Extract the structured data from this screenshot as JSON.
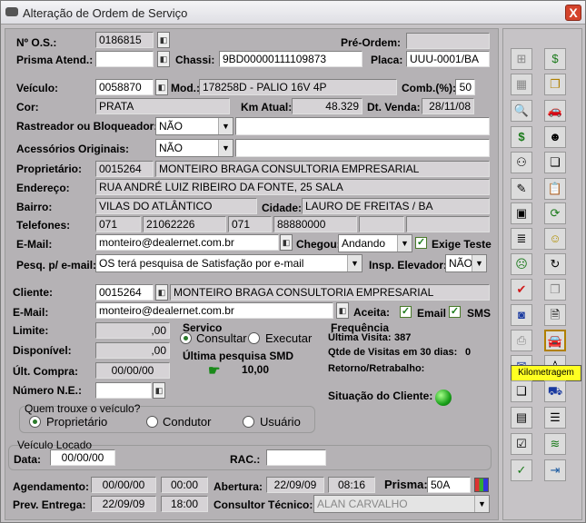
{
  "window": {
    "title": "Alteração de Ordem de Serviço",
    "close": "X"
  },
  "os": {
    "label": "Nº O.S.:",
    "value": "0186815",
    "pre_ordem_label": "Pré-Ordem:",
    "pre_ordem_value": "",
    "prisma_atend_label": "Prisma Atend.:",
    "prisma_atend_value": "",
    "chassi_label": "Chassi:",
    "chassi_value": "9BD00000111109873",
    "placa_label": "Placa:",
    "placa_value": "UUU-0001/BA"
  },
  "veiculo": {
    "label": "Veículo:",
    "code": "0058870",
    "mod_label": "Mod.:",
    "mod_value": "178258D - PALIO 16V 4P",
    "comb_label": "Comb.(%):",
    "comb_value": "50",
    "cor_label": "Cor:",
    "cor_value": "PRATA",
    "km_label": "Km Atual:",
    "km_value": "48.329",
    "dtvenda_label": "Dt. Venda:",
    "dtvenda_value": "28/11/08",
    "rastreador_label": "Rastreador ou Bloqueador:",
    "rastreador_value": "NÃO",
    "rastreador_text": "",
    "acessorios_label": "Acessórios Originais:",
    "acessorios_value": "NÃO",
    "acessorios_text": ""
  },
  "proprietario": {
    "label": "Proprietário:",
    "code": "0015264",
    "name": "MONTEIRO BRAGA CONSULTORIA EMPRESARIAL",
    "endereco_label": "Endereço:",
    "endereco_value": "RUA ANDRÉ LUIZ RIBEIRO DA FONTE, 25 SALA",
    "bairro_label": "Bairro:",
    "bairro_value": "VILAS DO ATLÂNTICO",
    "cidade_label": "Cidade:",
    "cidade_value": "LAURO DE FREITAS / BA",
    "telefones_label": "Telefones:",
    "ddd1": "071",
    "tel1": "21062226",
    "ddd2": "071",
    "tel2": "88880000",
    "email_label": "E-Mail:",
    "email_value": "monteiro@dealernet.com.br",
    "chegou_label": "Chegou:",
    "chegou_value": "Andando",
    "exige_teste_label": "Exige Teste",
    "pesq_label": "Pesq. p/ e-mail:",
    "pesq_value": "OS terá pesquisa de Satisfação por e-mail",
    "insp_label": "Insp. Elevador:",
    "insp_value": "NÃO"
  },
  "cliente": {
    "label": "Cliente:",
    "code": "0015264",
    "name": "MONTEIRO BRAGA CONSULTORIA EMPRESARIAL",
    "email_label": "E-Mail:",
    "email_value": "monteiro@dealernet.com.br",
    "aceita_label": "Aceita:",
    "email_opt": "Email",
    "sms_opt": "SMS",
    "limite_label": "Limite:",
    "limite_value": ",00",
    "disponivel_label": "Disponível:",
    "disponivel_value": ",00",
    "ultcompra_label": "Últ. Compra:",
    "ultcompra_value": "00/00/00",
    "ne_label": "Número N.E.:",
    "ne_value": ""
  },
  "servico": {
    "title": "Servico",
    "opt1": "Consultar",
    "opt2": "Executar",
    "ultima_label": "Última pesquisa SMD",
    "ultima_value": "10,00"
  },
  "frequencia": {
    "title": "Frequência",
    "ultima_visita_label": "Última Visita:",
    "ultima_visita_value": "387",
    "qtde_label": "Qtde de Visitas em 30 dias:",
    "qtde_value": "0",
    "retorno_label": "Retorno/Retrabalho:"
  },
  "situacao": {
    "label": "Situação do Cliente:",
    "color": "#1aa01a"
  },
  "quem_trouxe": {
    "title": "Quem trouxe o veículo?",
    "opt1": "Proprietário",
    "opt2": "Condutor",
    "opt3": "Usuário"
  },
  "veiculo_locado": {
    "title": "Veículo Locado",
    "data_label": "Data:",
    "data_value": "00/00/00",
    "rac_label": "RAC.:",
    "rac_value": ""
  },
  "agendamento": {
    "label": "Agendamento:",
    "date": "00/00/00",
    "time": "00:00",
    "abertura_label": "Abertura:",
    "abertura_date": "22/09/09",
    "abertura_time": "08:16",
    "prisma_label": "Prisma:",
    "prisma_value": "50A",
    "prev_label": "Prev. Entrega:",
    "prev_date": "22/09/09",
    "prev_time": "18:00",
    "consultor_label": "Consultor Técnico:",
    "consultor_value": "ALAN CARVALHO"
  },
  "tooltip": "Kilometragem"
}
